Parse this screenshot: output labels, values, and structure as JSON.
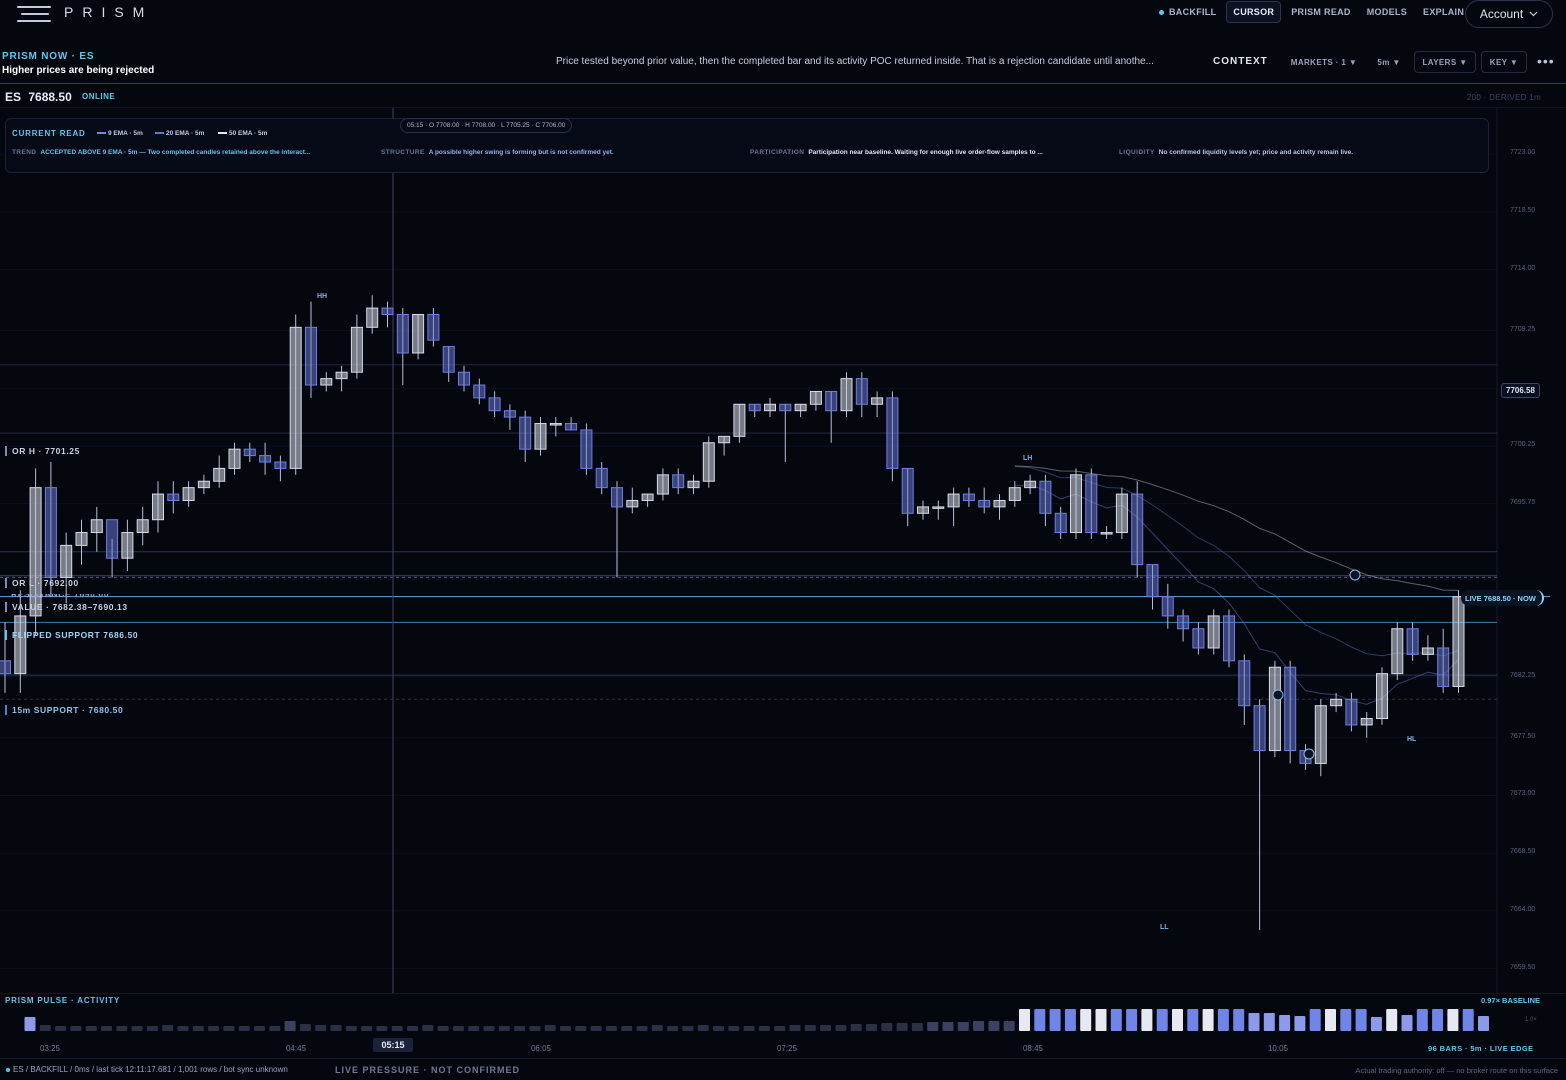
{
  "app": {
    "name": "PRISM"
  },
  "nav": {
    "items": [
      {
        "label": "BACKFILL",
        "active": false,
        "live": true
      },
      {
        "label": "CURSOR",
        "active": true,
        "live": false
      },
      {
        "label": "PRISM READ",
        "active": false,
        "live": false
      },
      {
        "label": "MODELS",
        "active": false,
        "live": false
      },
      {
        "label": "EXPLAIN",
        "active": false,
        "live": false
      }
    ],
    "account_label": "Account"
  },
  "now": {
    "label": "PRISM NOW · ES",
    "headline": "Higher prices are being rejected",
    "summary": "Price tested beyond prior value, then the completed bar and its activity POC returned inside. That is a rejection candidate until anothe...",
    "context_label": "CONTEXT",
    "markets_label": "MARKETS · 1 ▼",
    "timeframe_label": "5m ▼",
    "layers_label": "LAYERS ▼",
    "key_label": "KEY ▼",
    "more_label": "•••"
  },
  "symbol": {
    "ticker": "ES",
    "price": "7688.50",
    "status": "ONLINE",
    "meta": "200 · DERIVED 1m"
  },
  "read": {
    "title": "CURRENT READ",
    "ema_legend": [
      {
        "label": "9 EMA · 5m",
        "color": "#6f86e8"
      },
      {
        "label": "20 EMA · 5m",
        "color": "#4a84c9"
      },
      {
        "label": "50 EMA · 5m",
        "color": "#e6e9f2"
      }
    ],
    "cursor_ohlc": "05:15 · O 7708.00 · H 7708.00 · L 7705.25 · C 7706.00",
    "trend_key": "TREND",
    "trend_value": "ACCEPTED ABOVE 9 EMA · 5m — Two completed candles retained above the interact...",
    "structure_key": "STRUCTURE",
    "structure_value": "A possible higher swing is forming but is not confirmed yet.",
    "participation_key": "PARTICIPATION",
    "participation_value": "Participation near baseline. Waiting for enough live order-flow samples to ...",
    "liquidity_key": "LIQUIDITY",
    "liquidity_value": "No confirmed liquidity levels yet; price and activity remain live."
  },
  "chart": {
    "price_tag": "7706.58",
    "live_tag": "LIVE 7688.50 · NOW",
    "levels": {
      "or_high": "OR H · 7701.25",
      "or_low": "OR L · 7692.00",
      "resistance": "RESISTANCE 7690.00",
      "value_area": "VALUE · 7682.38–7690.13",
      "flipped_support": "FLIPPED SUPPORT 7686.50",
      "support_15m": "15m SUPPORT · 7680.50"
    },
    "swings": {
      "hh": "HH",
      "lh": "LH",
      "ll": "LL",
      "hl": "HL"
    }
  },
  "pulse": {
    "title": "PRISM PULSE · ACTIVITY",
    "baseline": "0.97× BASELINE",
    "scale": "1.0×",
    "cursor_time": "05:15",
    "bars_info": "96 BARS · 5m · LIVE EDGE"
  },
  "footer": {
    "status": "ES / BACKFILL / 0ms / last tick 12:11:17.681 / 1,001 rows / bot sync unknown",
    "pressure": "LIVE PRESSURE · NOT CONFIRMED",
    "authority": "Actual trading authority: off — no broker route on this surface"
  },
  "colors": {
    "background": "#05070e",
    "accent": "#5cc8f0",
    "candle_up": "#d5dbe9",
    "candle_down": "#6d7fe6",
    "level_line": "#3a4563"
  },
  "chart_data": {
    "type": "candlestick",
    "symbol": "ES",
    "interval": "5m",
    "ylim": [
      7657.6,
      7726.6
    ],
    "y_ticks": [
      "7723.00",
      "7718.50",
      "7714.00",
      "7709.25",
      "7704.75",
      "7700.25",
      "7695.75",
      "7682.25",
      "7677.50",
      "7673.00",
      "7668.50",
      "7664.00",
      "7659.50"
    ],
    "x_ticks": [
      "03:25",
      "04:45",
      "06:05",
      "07:25",
      "08:45",
      "10:05"
    ],
    "candles": [
      [
        7683.5,
        7686.5,
        7681.0,
        7682.5
      ],
      [
        7682.5,
        7689.0,
        7681.0,
        7687.0
      ],
      [
        7687.0,
        7698.5,
        7685.5,
        7697.0
      ],
      [
        7697.0,
        7699.0,
        7688.5,
        7690.0
      ],
      [
        7690.0,
        7693.5,
        7688.0,
        7692.5
      ],
      [
        7692.5,
        7694.5,
        7691.0,
        7693.5
      ],
      [
        7693.5,
        7695.5,
        7692.0,
        7694.5
      ],
      [
        7694.5,
        7693.0,
        7690.0,
        7691.5
      ],
      [
        7691.5,
        7694.5,
        7690.5,
        7693.5
      ],
      [
        7693.5,
        7695.5,
        7692.5,
        7694.5
      ],
      [
        7694.5,
        7697.5,
        7693.5,
        7696.5
      ],
      [
        7696.5,
        7697.5,
        7695.0,
        7696.0
      ],
      [
        7696.0,
        7697.5,
        7695.5,
        7697.0
      ],
      [
        7697.0,
        7698.0,
        7696.5,
        7697.5
      ],
      [
        7697.5,
        7699.5,
        7697.0,
        7698.5
      ],
      [
        7698.5,
        7700.5,
        7698.0,
        7700.0
      ],
      [
        7700.0,
        7700.5,
        7699.0,
        7699.5
      ],
      [
        7699.5,
        7700.5,
        7698.0,
        7699.0
      ],
      [
        7699.0,
        7699.5,
        7697.5,
        7698.5
      ],
      [
        7698.5,
        7710.5,
        7698.0,
        7709.5
      ],
      [
        7709.5,
        7711.5,
        7704.0,
        7705.0
      ],
      [
        7705.0,
        7706.0,
        7704.5,
        7705.5
      ],
      [
        7705.5,
        7706.5,
        7704.5,
        7706.0
      ],
      [
        7706.0,
        7710.5,
        7705.5,
        7709.5
      ],
      [
        7709.5,
        7712.0,
        7709.0,
        7711.0
      ],
      [
        7711.0,
        7711.5,
        7709.5,
        7710.5
      ],
      [
        7710.5,
        7711.0,
        7705.0,
        7707.5
      ],
      [
        7707.5,
        7710.5,
        7707.0,
        7710.5
      ],
      [
        7710.5,
        7711.0,
        7708.0,
        7708.5
      ],
      [
        7708.0,
        7708.0,
        7705.25,
        7706.0
      ],
      [
        7706.0,
        7706.5,
        7704.5,
        7705.0
      ],
      [
        7705.0,
        7705.5,
        7703.5,
        7704.0
      ],
      [
        7704.0,
        7704.5,
        7702.5,
        7703.0
      ],
      [
        7703.0,
        7703.5,
        7701.5,
        7702.5
      ],
      [
        7702.5,
        7703.0,
        7699.0,
        7700.0
      ],
      [
        7700.0,
        7702.5,
        7699.5,
        7702.0
      ],
      [
        7702.0,
        7702.5,
        7701.0,
        7702.0
      ],
      [
        7702.0,
        7702.5,
        7701.5,
        7701.5
      ],
      [
        7701.5,
        7702.0,
        7698.0,
        7698.5
      ],
      [
        7698.5,
        7699.0,
        7696.5,
        7697.0
      ],
      [
        7697.0,
        7697.5,
        7690.0,
        7695.5
      ],
      [
        7695.5,
        7697.0,
        7695.0,
        7696.0
      ],
      [
        7696.0,
        7696.5,
        7695.5,
        7696.5
      ],
      [
        7696.5,
        7698.5,
        7696.0,
        7698.0
      ],
      [
        7698.0,
        7698.5,
        7696.5,
        7697.0
      ],
      [
        7697.0,
        7698.0,
        7696.5,
        7697.5
      ],
      [
        7697.5,
        7701.0,
        7697.0,
        7700.5
      ],
      [
        7700.5,
        7701.0,
        7699.5,
        7701.0
      ],
      [
        7701.0,
        7703.5,
        7700.5,
        7703.5
      ],
      [
        7703.5,
        7703.5,
        7702.5,
        7703.0
      ],
      [
        7703.0,
        7704.0,
        7702.5,
        7703.5
      ],
      [
        7703.5,
        7703.5,
        7699.0,
        7703.0
      ],
      [
        7703.0,
        7703.5,
        7702.5,
        7703.5
      ],
      [
        7703.5,
        7704.5,
        7703.0,
        7704.5
      ],
      [
        7704.5,
        7704.5,
        7700.5,
        7703.0
      ],
      [
        7703.0,
        7706.0,
        7702.5,
        7705.5
      ],
      [
        7705.5,
        7706.0,
        7702.5,
        7703.5
      ],
      [
        7703.5,
        7704.5,
        7702.5,
        7704.0
      ],
      [
        7704.0,
        7704.5,
        7697.5,
        7698.5
      ],
      [
        7698.5,
        7698.5,
        7694.0,
        7695.0
      ],
      [
        7695.0,
        7696.0,
        7694.5,
        7695.5
      ],
      [
        7695.5,
        7696.0,
        7694.5,
        7695.5
      ],
      [
        7695.5,
        7697.0,
        7694.0,
        7696.5
      ],
      [
        7696.5,
        7697.0,
        7695.5,
        7696.0
      ],
      [
        7696.0,
        7697.0,
        7695.0,
        7695.5
      ],
      [
        7695.5,
        7696.5,
        7694.5,
        7696.0
      ],
      [
        7696.0,
        7697.5,
        7695.5,
        7697.0
      ],
      [
        7697.0,
        7698.0,
        7696.5,
        7697.5
      ],
      [
        7697.5,
        7698.0,
        7694.0,
        7695.0
      ],
      [
        7695.0,
        7695.5,
        7693.0,
        7693.5
      ],
      [
        7693.5,
        7698.5,
        7693.0,
        7698.0
      ],
      [
        7698.0,
        7698.5,
        7693.0,
        7693.5
      ],
      [
        7693.5,
        7694.0,
        7693.0,
        7693.5
      ],
      [
        7693.5,
        7697.0,
        7693.0,
        7696.5
      ],
      [
        7696.5,
        7697.5,
        7690.0,
        7691.0
      ],
      [
        7691.0,
        7691.0,
        7687.5,
        7688.5
      ],
      [
        7688.5,
        7689.5,
        7686.0,
        7687.0
      ],
      [
        7687.0,
        7687.5,
        7685.0,
        7686.0
      ],
      [
        7686.0,
        7686.5,
        7684.0,
        7684.5
      ],
      [
        7684.5,
        7687.5,
        7684.0,
        7687.0
      ],
      [
        7687.0,
        7687.5,
        7683.0,
        7683.5
      ],
      [
        7683.5,
        7684.0,
        7678.5,
        7680.0
      ],
      [
        7680.0,
        7680.5,
        7662.5,
        7676.5
      ],
      [
        7676.5,
        7683.5,
        7676.0,
        7683.0
      ],
      [
        7683.0,
        7683.5,
        7675.5,
        7676.5
      ],
      [
        7676.5,
        7677.0,
        7675.0,
        7675.5
      ],
      [
        7675.5,
        7680.5,
        7674.5,
        7680.0
      ],
      [
        7680.0,
        7681.0,
        7679.5,
        7680.5
      ],
      [
        7680.5,
        7681.0,
        7678.0,
        7678.5
      ],
      [
        7678.5,
        7679.5,
        7677.5,
        7679.0
      ],
      [
        7679.0,
        7683.0,
        7678.5,
        7682.5
      ],
      [
        7682.5,
        7686.5,
        7682.0,
        7686.0
      ],
      [
        7686.0,
        7686.5,
        7683.5,
        7684.0
      ],
      [
        7684.0,
        7685.5,
        7683.5,
        7684.5
      ],
      [
        7684.5,
        7686.0,
        7681.0,
        7681.5
      ],
      [
        7681.5,
        7689.0,
        7681.0,
        7688.5
      ]
    ],
    "ema_9": "line",
    "ema_20": "line",
    "ema_50": "line",
    "activity": [
      1.4,
      0.6,
      0.5,
      0.5,
      0.5,
      0.5,
      0.5,
      0.5,
      0.5,
      0.6,
      0.5,
      0.5,
      0.5,
      0.5,
      0.5,
      0.5,
      0.5,
      1.0,
      0.7,
      0.6,
      0.6,
      0.5,
      0.5,
      0.5,
      0.5,
      0.5,
      0.6,
      0.5,
      0.5,
      0.5,
      0.5,
      0.5,
      0.5,
      0.5,
      0.6,
      0.5,
      0.5,
      0.5,
      0.5,
      0.5,
      0.5,
      0.6,
      0.5,
      0.5,
      0.6,
      0.5,
      0.5,
      0.5,
      0.5,
      0.5,
      0.6,
      0.6,
      0.6,
      0.6,
      0.7,
      0.7,
      0.8,
      0.8,
      0.8,
      0.9,
      0.9,
      0.9,
      1.0,
      1.0,
      1.0,
      2.2,
      2.2,
      2.2,
      2.2,
      2.2,
      2.2,
      2.2,
      2.2,
      2.2,
      2.2,
      2.2,
      2.2,
      2.2,
      2.2,
      2.2,
      1.8,
      1.8,
      1.6,
      1.5,
      2.2,
      2.2,
      2.2,
      2.2,
      1.4,
      2.2,
      1.6,
      2.2,
      2.2,
      2.2,
      2.2,
      1.5
    ]
  }
}
